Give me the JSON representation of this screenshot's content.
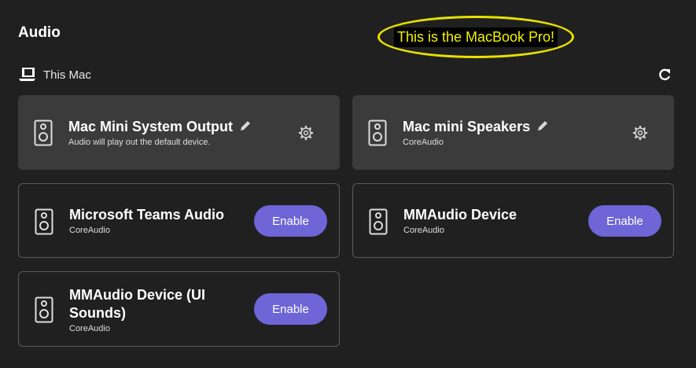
{
  "header": {
    "title": "Audio",
    "callout": "This is the MacBook Pro!"
  },
  "group": {
    "label": "This Mac",
    "icon": "laptop-icon",
    "refresh_icon": "refresh-icon"
  },
  "devices": [
    {
      "name": "Mac Mini System Output",
      "subtitle": "Audio will play out the default device.",
      "state": "active"
    },
    {
      "name": "Mac mini Speakers",
      "subtitle": "CoreAudio",
      "state": "active"
    },
    {
      "name": "Microsoft Teams Audio",
      "subtitle": "CoreAudio",
      "button": "Enable",
      "state": "inactive"
    },
    {
      "name": "MMAudio Device",
      "subtitle": "CoreAudio",
      "button": "Enable",
      "state": "inactive"
    },
    {
      "name": "MMAudio Device (UI Sounds)",
      "subtitle": "CoreAudio",
      "button": "Enable",
      "state": "inactive"
    }
  ],
  "colors": {
    "background": "#202020",
    "card_active": "#3b3b3b",
    "card_border": "#5a5a5a",
    "button": "#6e66d6",
    "callout_text": "#f2f200",
    "callout_border": "#e8e000"
  }
}
